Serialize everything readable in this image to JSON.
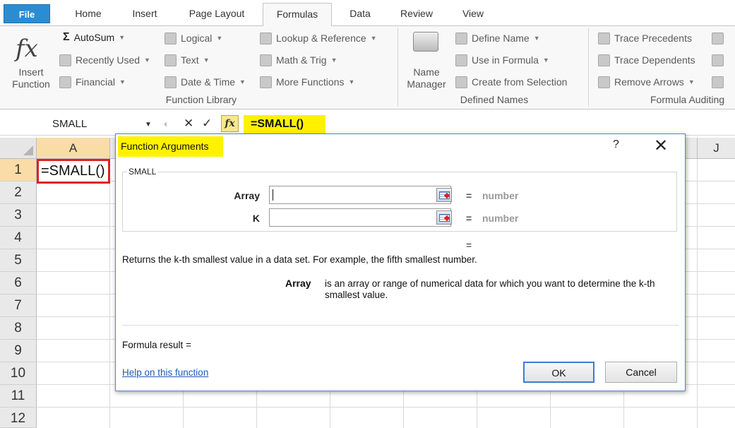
{
  "ribbon_tabs": [
    "File",
    "Home",
    "Insert",
    "Page Layout",
    "Formulas",
    "Data",
    "Review",
    "View"
  ],
  "active_tab": "Formulas",
  "ribbon": {
    "insert_function": [
      "Insert",
      "Function"
    ],
    "function_library": {
      "autosum": "AutoSum",
      "recently_used": "Recently Used",
      "financial": "Financial",
      "logical": "Logical",
      "text": "Text",
      "date_time": "Date & Time",
      "lookup_reference": "Lookup & Reference",
      "math_trig": "Math & Trig",
      "more_functions": "More Functions",
      "label": "Function Library"
    },
    "defined_names": {
      "name_manager": [
        "Name",
        "Manager"
      ],
      "define_name": "Define Name",
      "use_in_formula": "Use in Formula",
      "create_from_selection": "Create from Selection",
      "label": "Defined Names"
    },
    "formula_auditing": {
      "trace_precedents": "Trace Precedents",
      "trace_dependents": "Trace Dependents",
      "remove_arrows": "Remove Arrows",
      "label": "Formula Auditing"
    }
  },
  "formula_bar": {
    "name_box": "SMALL",
    "cancel_symbol": "✕",
    "enter_symbol": "✓",
    "fx_symbol": "fx",
    "formula": "=SMALL()"
  },
  "grid": {
    "columns": [
      "A",
      "",
      "",
      "",
      "",
      "",
      "",
      "",
      "",
      "J"
    ],
    "rows": [
      "1",
      "2",
      "3",
      "4",
      "5",
      "6",
      "7",
      "8",
      "9",
      "10",
      "11",
      "12"
    ],
    "cell_a1": "=SMALL()"
  },
  "dialog": {
    "title": "Function Arguments",
    "help_glyph": "?",
    "close_glyph": "✕",
    "function_name": "SMALL",
    "arguments": [
      {
        "label": "Array",
        "value": "",
        "result_eq": "=",
        "result": "number"
      },
      {
        "label": "K",
        "value": "",
        "result_eq": "=",
        "result": "number"
      }
    ],
    "overall_eq": "=",
    "description": "Returns the k-th smallest value in a data set. For example, the fifth smallest number.",
    "arg_desc_name": "Array",
    "arg_desc_text": "is an array or range of numerical data for which you want to determine the k-th smallest value.",
    "formula_result": "Formula result =",
    "help_link": "Help on this function",
    "ok": "OK",
    "cancel": "Cancel"
  },
  "colors": {
    "highlight": "#fff200",
    "selection_border": "#e0201e",
    "file_tab": "#2a8dd4",
    "link": "#1c5bb5"
  }
}
